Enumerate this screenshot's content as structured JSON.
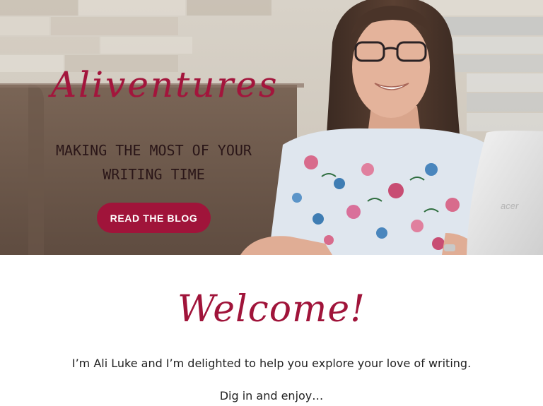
{
  "hero": {
    "site_title": "Aliventures",
    "tagline": "Making the most of your writing time",
    "cta_label": "READ THE BLOG",
    "laptop_brand": "acer"
  },
  "welcome": {
    "heading": "Welcome!",
    "intro": "I’m Ali Luke and I’m delighted to help you explore your love of writing.",
    "dig_in": "Dig in and enjoy…"
  },
  "colors": {
    "brand": "#a0143a",
    "tagline": "#2a1618",
    "body_text": "#222222"
  }
}
